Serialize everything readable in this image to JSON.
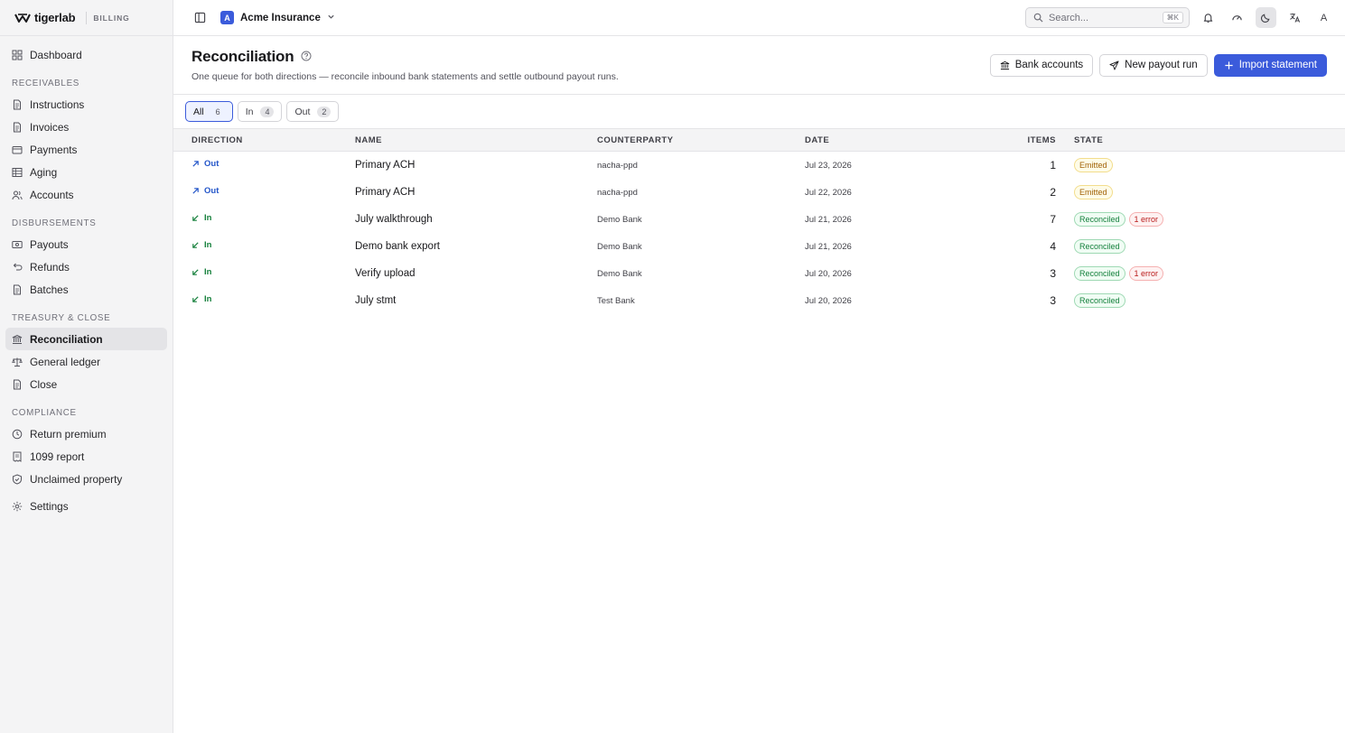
{
  "brand": {
    "name": "tigerlab",
    "tag": "BILLING"
  },
  "sidebar": {
    "top": [
      {
        "label": "Dashboard",
        "icon": "grid-icon"
      }
    ],
    "sections": [
      {
        "title": "RECEIVABLES",
        "items": [
          {
            "label": "Instructions",
            "icon": "doc-icon"
          },
          {
            "label": "Invoices",
            "icon": "doc-icon"
          },
          {
            "label": "Payments",
            "icon": "wallet-icon"
          },
          {
            "label": "Aging",
            "icon": "table-icon"
          },
          {
            "label": "Accounts",
            "icon": "users-icon"
          }
        ]
      },
      {
        "title": "DISBURSEMENTS",
        "items": [
          {
            "label": "Payouts",
            "icon": "banknote-icon"
          },
          {
            "label": "Refunds",
            "icon": "refund-icon"
          },
          {
            "label": "Batches",
            "icon": "doc-icon"
          }
        ]
      },
      {
        "title": "TREASURY & CLOSE",
        "items": [
          {
            "label": "Reconciliation",
            "icon": "bank-icon",
            "active": true
          },
          {
            "label": "General ledger",
            "icon": "scale-icon"
          },
          {
            "label": "Close",
            "icon": "doc-icon"
          }
        ]
      },
      {
        "title": "COMPLIANCE",
        "items": [
          {
            "label": "Return premium",
            "icon": "clock-icon"
          },
          {
            "label": "1099 report",
            "icon": "receipt-icon"
          },
          {
            "label": "Unclaimed property",
            "icon": "shield-icon"
          }
        ]
      }
    ],
    "bottom": [
      {
        "label": "Settings",
        "icon": "gear-icon"
      }
    ]
  },
  "topbar": {
    "workspace_initial": "A",
    "workspace_name": "Acme Insurance",
    "search_placeholder": "Search...",
    "search_shortcut": "⌘K",
    "avatar": "A"
  },
  "page": {
    "title": "Reconciliation",
    "subtitle": "One queue for both directions — reconcile inbound bank statements and settle outbound payout runs.",
    "buttons": {
      "bank_accounts": "Bank accounts",
      "new_payout_run": "New payout run",
      "import_statement": "Import statement"
    }
  },
  "tabs": [
    {
      "label": "All",
      "count": "6",
      "active": true
    },
    {
      "label": "In",
      "count": "4"
    },
    {
      "label": "Out",
      "count": "2"
    }
  ],
  "table": {
    "headers": {
      "direction": "DIRECTION",
      "name": "NAME",
      "counterparty": "COUNTERPARTY",
      "date": "DATE",
      "items": "ITEMS",
      "state": "STATE"
    },
    "rows": [
      {
        "direction": "Out",
        "name": "Primary ACH",
        "counterparty": "nacha-ppd",
        "date": "Jul 23, 2026",
        "items": "1",
        "state": "Emitted",
        "error": ""
      },
      {
        "direction": "Out",
        "name": "Primary ACH",
        "counterparty": "nacha-ppd",
        "date": "Jul 22, 2026",
        "items": "2",
        "state": "Emitted",
        "error": ""
      },
      {
        "direction": "In",
        "name": "July walkthrough",
        "counterparty": "Demo Bank",
        "date": "Jul 21, 2026",
        "items": "7",
        "state": "Reconciled",
        "error": "1 error"
      },
      {
        "direction": "In",
        "name": "Demo bank export",
        "counterparty": "Demo Bank",
        "date": "Jul 21, 2026",
        "items": "4",
        "state": "Reconciled",
        "error": ""
      },
      {
        "direction": "In",
        "name": "Verify upload",
        "counterparty": "Demo Bank",
        "date": "Jul 20, 2026",
        "items": "3",
        "state": "Reconciled",
        "error": "1 error"
      },
      {
        "direction": "In",
        "name": "July stmt",
        "counterparty": "Test Bank",
        "date": "Jul 20, 2026",
        "items": "3",
        "state": "Reconciled",
        "error": ""
      }
    ]
  },
  "colors": {
    "accent": "#3b5bdb",
    "out": "#2456c9",
    "in": "#16803c",
    "emitted": "#a16207",
    "reconciled": "#15803d",
    "error": "#b91c1c"
  }
}
